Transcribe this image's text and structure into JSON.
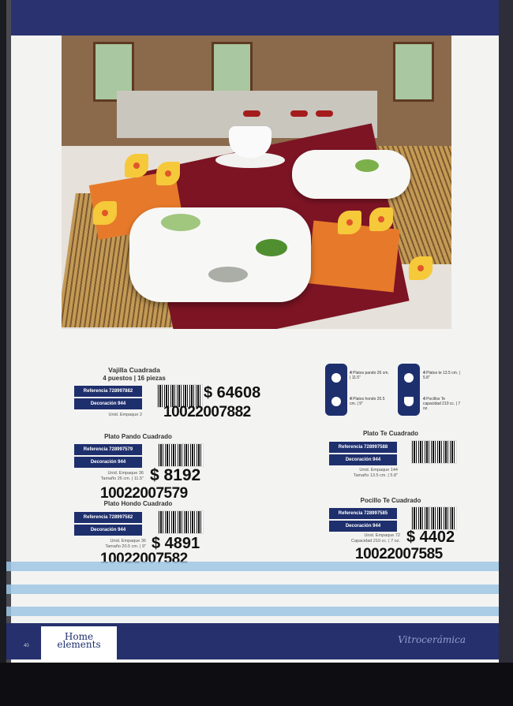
{
  "page": {
    "number": "40",
    "section": "Vitrocerámica"
  },
  "brand": {
    "logo_line1": "Home",
    "logo_line2": "elements"
  },
  "products": {
    "set": {
      "title": "Vajilla Cuadrada",
      "subtitle": "4 puestos | 16 piezas",
      "reference": "Referencia  728997882",
      "decoration": "Decoración  944",
      "unit": "Unid. Empaque 2",
      "price": "$ 64608",
      "code": "10022007882"
    },
    "plato_pando": {
      "title": "Plato Pando Cuadrado",
      "reference": "Referencia  728997579",
      "decoration": "Decoración  944",
      "unit": "Unid. Empaque 36",
      "size": "Tamaño 26 cm. | 11.5\"",
      "price": "$ 8192",
      "code": "10022007579"
    },
    "plato_hondo": {
      "title": "Plato Hondo Cuadrado",
      "reference": "Referencia  728997582",
      "decoration": "Decoración  944",
      "unit": "Unid. Empaque 36",
      "size": "Tamaño 20.5 cm. | 9\"",
      "price": "$ 4891",
      "code": "10022007582"
    },
    "plato_te": {
      "title": "Plato Te Cuadrado",
      "reference": "Referencia  728997588",
      "decoration": "Decoración  944",
      "unit": "Unid. Empaque 144",
      "size": "Tamaño 13.5 cm. | 5.8\""
    },
    "pocillo_te": {
      "title": "Pocillo Te Cuadrado",
      "reference": "Referencia  728997585",
      "decoration": "Decoración  944",
      "unit": "Unid. Empaque 72",
      "capacity": "Capacidad 210 cc. | 7 oz.",
      "price": "$ 4402",
      "code": "10022007585"
    }
  },
  "set_contents": {
    "left": [
      {
        "count": "4",
        "label": "Platos pando 26 cm. | 11.5\""
      },
      {
        "count": "4",
        "label": "Platos hondo 20.5 cm. | 9\""
      }
    ],
    "right": [
      {
        "count": "4",
        "label": "Platos te 13.5 cm. | 5.8\""
      },
      {
        "count": "4",
        "label": "Pocillos Te capacidad 210 cc. | 7 oz."
      }
    ]
  },
  "colors": {
    "brand_blue": "#1e2f6d",
    "stripe": "#9ec6e4",
    "footer": "#26306d"
  }
}
